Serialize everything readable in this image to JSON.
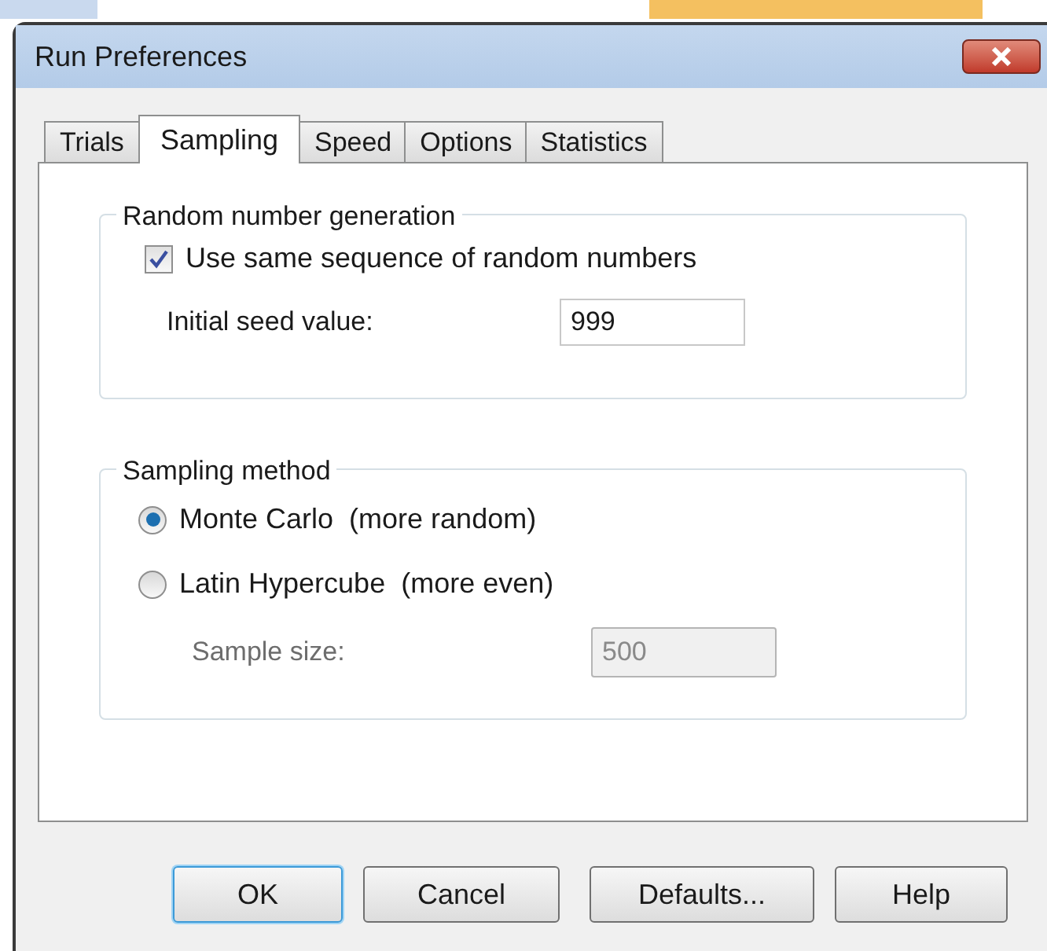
{
  "window": {
    "title": "Run Preferences"
  },
  "tabs": [
    {
      "label": "Trials",
      "selected": false
    },
    {
      "label": "Sampling",
      "selected": true
    },
    {
      "label": "Speed",
      "selected": false
    },
    {
      "label": "Options",
      "selected": false
    },
    {
      "label": "Statistics",
      "selected": false
    }
  ],
  "random_number_generation": {
    "title": "Random number generation",
    "same_sequence": {
      "label": "Use same sequence of random numbers",
      "checked": true
    },
    "seed": {
      "label": "Initial seed value:",
      "value": "999"
    }
  },
  "sampling_method": {
    "title": "Sampling method",
    "options": [
      {
        "label": "Monte Carlo  (more random)",
        "selected": true
      },
      {
        "label": "Latin Hypercube  (more even)",
        "selected": false
      }
    ],
    "sample_size": {
      "label": "Sample size:",
      "value": "500",
      "disabled": true
    }
  },
  "buttons": [
    {
      "label": "OK",
      "default": true
    },
    {
      "label": "Cancel",
      "default": false
    },
    {
      "label": "Defaults...",
      "default": false
    },
    {
      "label": "Help",
      "default": false
    }
  ]
}
